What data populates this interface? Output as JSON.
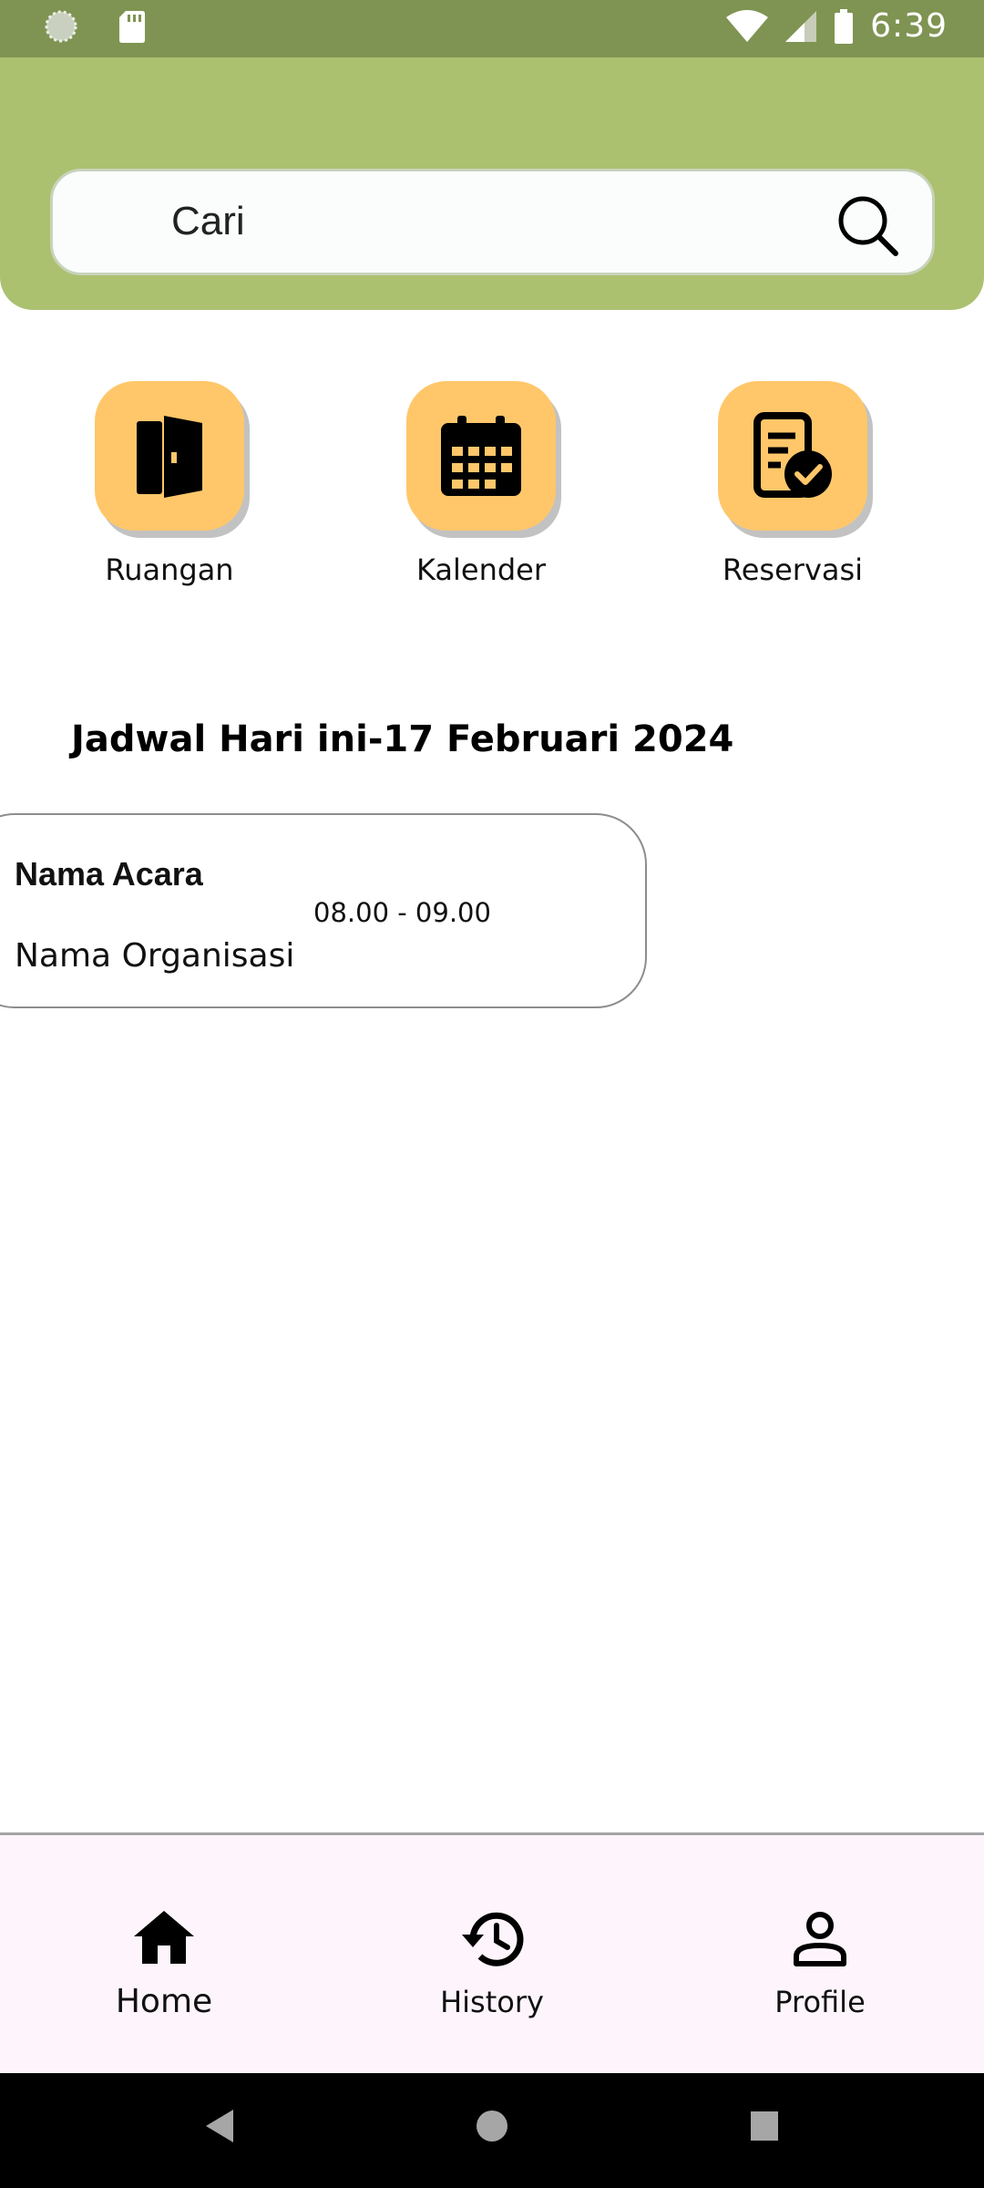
{
  "status_bar": {
    "time": "6:39",
    "icons": [
      "spinner-icon",
      "sd-card-icon",
      "wifi-icon",
      "signal-icon",
      "battery-icon"
    ]
  },
  "search": {
    "placeholder": "Cari",
    "icon": "search-icon"
  },
  "quick_menu": [
    {
      "label": "Ruangan",
      "icon": "door-icon"
    },
    {
      "label": "Kalender",
      "icon": "calendar-icon"
    },
    {
      "label": "Reservasi",
      "icon": "reservation-check-icon"
    }
  ],
  "schedule": {
    "title": "Jadwal Hari ini-17 Februari 2024",
    "events": [
      {
        "name": "Nama Acara",
        "time": "08.00 - 09.00",
        "organization": "Nama Organisasi"
      }
    ]
  },
  "bottom_nav": {
    "items": [
      {
        "label": "Home",
        "icon": "home-icon",
        "active": true
      },
      {
        "label": "History",
        "icon": "history-icon",
        "active": false
      },
      {
        "label": "Profile",
        "icon": "profile-icon",
        "active": false
      }
    ]
  },
  "colors": {
    "status_bar": "#7f9452",
    "header": "#abc170",
    "menu_button": "#ffc76a",
    "bottom_nav": "#fdf5fb"
  }
}
